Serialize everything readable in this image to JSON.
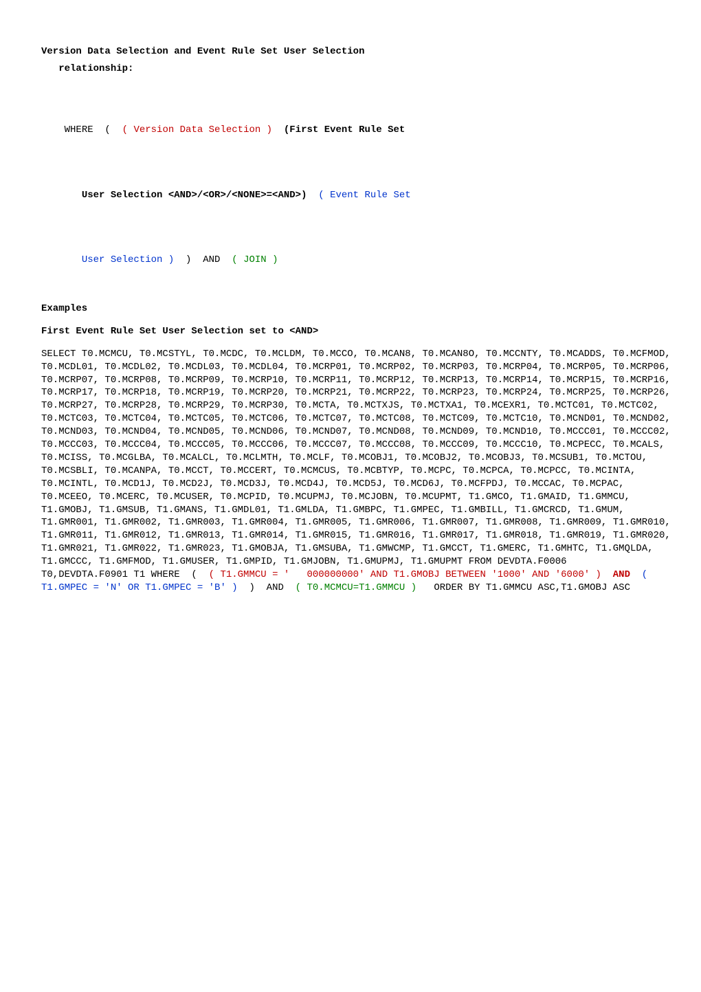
{
  "heading1_line1": "Version Data Selection and Event Rule Set User Selection",
  "heading1_line2": "relationship:",
  "where_prefix": "WHERE  ( ",
  "vds_span": " ( Version Data Selection ) ",
  "first_ers_line1": " (First Event Rule Set",
  "first_ers_line2": "User Selection <AND>/<OR>/<NONE>=<AND>)",
  "ers_span1": "  ( Event Rule Set",
  "ers_span2": "User Selection ) ",
  "after_ers": " )  AND ",
  "join_span": " ( JOIN )",
  "examples_heading": "Examples",
  "example1_heading": "First Event Rule Set User Selection set to <AND>",
  "query_black_block": "SELECT T0.MCMCU, T0.MCSTYL, T0.MCDC, T0.MCLDM, T0.MCCO, T0.MCAN8, T0.MCAN8O, T0.MCCNTY, T0.MCADDS, T0.MCFMOD, T0.MCDL01, T0.MCDL02, T0.MCDL03, T0.MCDL04, T0.MCRP01, T0.MCRP02, T0.MCRP03, T0.MCRP04, T0.MCRP05, T0.MCRP06, T0.MCRP07, T0.MCRP08, T0.MCRP09, T0.MCRP10, T0.MCRP11, T0.MCRP12, T0.MCRP13, T0.MCRP14, T0.MCRP15, T0.MCRP16, T0.MCRP17, T0.MCRP18, T0.MCRP19, T0.MCRP20, T0.MCRP21, T0.MCRP22, T0.MCRP23, T0.MCRP24, T0.MCRP25, T0.MCRP26, T0.MCRP27, T0.MCRP28, T0.MCRP29, T0.MCRP30, T0.MCTA, T0.MCTXJS, T0.MCTXA1, T0.MCEXR1, T0.MCTC01, T0.MCTC02, T0.MCTC03, T0.MCTC04, T0.MCTC05, T0.MCTC06, T0.MCTC07, T0.MCTC08, T0.MCTC09, T0.MCTC10, T0.MCND01, T0.MCND02, T0.MCND03, T0.MCND04, T0.MCND05, T0.MCND06, T0.MCND07, T0.MCND08, T0.MCND09, T0.MCND10, T0.MCCC01, T0.MCCC02, T0.MCCC03, T0.MCCC04, T0.MCCC05, T0.MCCC06, T0.MCCC07, T0.MCCC08, T0.MCCC09, T0.MCCC10, T0.MCPECC, T0.MCALS, T0.MCISS, T0.MCGLBA, T0.MCALCL, T0.MCLMTH, T0.MCLF, T0.MCOBJ1, T0.MCOBJ2, T0.MCOBJ3, T0.MCSUB1, T0.MCTOU, T0.MCSBLI, T0.MCANPA, T0.MCCT, T0.MCCERT, T0.MCMCUS, T0.MCBTYP, T0.MCPC, T0.MCPCA, T0.MCPCC, T0.MCINTA, T0.MCINTL, T0.MCD1J, T0.MCD2J, T0.MCD3J, T0.MCD4J, T0.MCD5J, T0.MCD6J, T0.MCFPDJ, T0.MCCAC, T0.MCPAC, T0.MCEEO, T0.MCERC, T0.MCUSER, T0.MCPID, T0.MCUPMJ, T0.MCJOBN, T0.MCUPMT, T1.GMCO, T1.GMAID, T1.GMMCU, T1.GMOBJ, T1.GMSUB, T1.GMANS, T1.GMDL01, T1.GMLDA, T1.GMBPC, T1.GMPEC, T1.GMBILL, T1.GMCRCD, T1.GMUM, T1.GMR001, T1.GMR002, T1.GMR003, T1.GMR004, T1.GMR005, T1.GMR006, T1.GMR007, T1.GMR008, T1.GMR009, T1.GMR010, T1.GMR011, T1.GMR012, T1.GMR013, T1.GMR014, T1.GMR015, T1.GMR016, T1.GMR017, T1.GMR018, T1.GMR019, T1.GMR020, T1.GMR021, T1.GMR022, T1.GMR023, T1.GMOBJA, T1.GMSUBA, T1.GMWCMP, T1.GMCCT, T1.GMERC, T1.GMHTC, T1.GMQLDA, T1.GMCCC, T1.GMFMOD, T1.GMUSER, T1.GMPID, T1.GMJOBN, T1.GMUPMJ, T1.GMUPMT FROM DEVDTA.F0006      T0,DEVDTA.F0901 T1 WHERE  ( ",
  "vds_red_1": " ( T1.GMMCU = '   000000000' AND T1.GMOBJ BETWEEN '1000' AND '6000' ) ",
  "and_bold": " AND ",
  "ers_blue_1": " ( T1.GMPEC = 'N' OR T1.GMPEC = 'B' ) ",
  "after_ers_black": " )  AND ",
  "join_green": " ( T0.MCMCU=T1.GMMCU ) ",
  "order_by_black": "  ORDER BY T1.GMMCU ASC,T1.GMOBJ ASC"
}
